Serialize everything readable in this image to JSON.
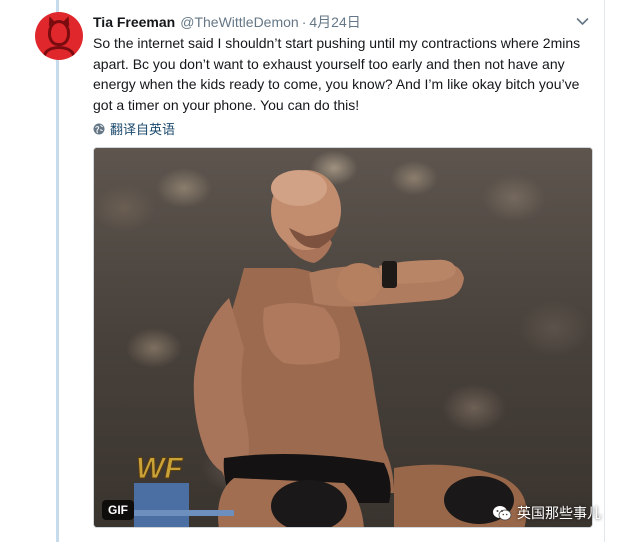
{
  "tweet": {
    "display_name": "Tia Freeman",
    "handle": "@TheWittleDemon",
    "separator": "·",
    "date": "4月24日",
    "text": "So the internet said I shouldn’t start pushing until my contractions where 2mins apart. Bc you don’t want to exhaust yourself too early and then not have any energy when the kids ready to come, you know? And I’m like okay bitch you’ve got a timer on your phone. You can do this!",
    "translate_label": "翻译自英语",
    "media": {
      "badge": "GIF",
      "logo_text": "WF"
    }
  },
  "watermark": {
    "label": "英国那些事儿",
    "icon": "wechat-icon"
  },
  "icons": {
    "caret": "chevron-down-icon",
    "translate": "globe-icon"
  },
  "colors": {
    "name": "#14171a",
    "secondary": "#657786",
    "thread_line": "#c6dcec",
    "avatar": "#e0272c",
    "translate_link": "#1b4a6e"
  }
}
